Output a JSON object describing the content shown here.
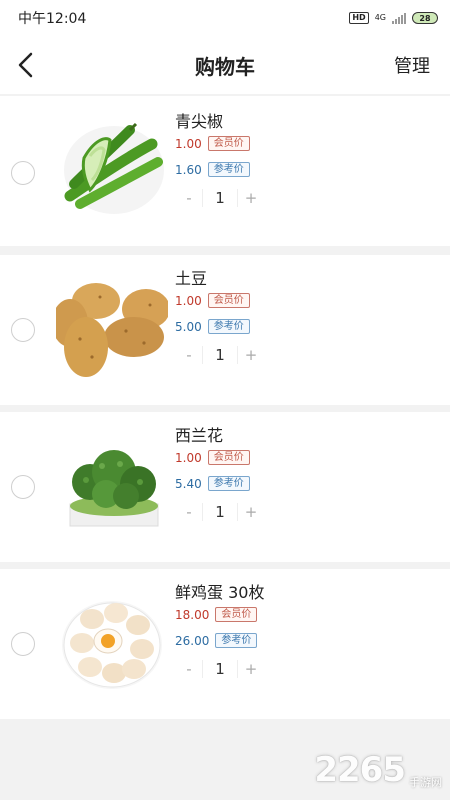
{
  "status": {
    "time": "中午12:04",
    "network": "4G",
    "battery": "28"
  },
  "header": {
    "title": "购物车",
    "manage": "管理"
  },
  "items": [
    {
      "name": "青尖椒",
      "member_price": "1.00",
      "member_tag": "会员价",
      "ref_price": "1.60",
      "ref_tag": "参考价",
      "minus": "-",
      "qty": "1",
      "plus": "+"
    },
    {
      "name": "土豆",
      "member_price": "1.00",
      "member_tag": "会员价",
      "ref_price": "5.00",
      "ref_tag": "参考价",
      "minus": "-",
      "qty": "1",
      "plus": "+"
    },
    {
      "name": "西兰花",
      "member_price": "1.00",
      "member_tag": "会员价",
      "ref_price": "5.40",
      "ref_tag": "参考价",
      "minus": "-",
      "qty": "1",
      "plus": "+"
    },
    {
      "name": "鲜鸡蛋 30枚",
      "member_price": "18.00",
      "member_tag": "会员价",
      "ref_price": "26.00",
      "ref_tag": "参考价",
      "minus": "-",
      "qty": "1",
      "plus": "+"
    }
  ],
  "watermark": {
    "number": "2265",
    "text": "手游网"
  },
  "colors": {
    "member": "#c0392b",
    "reference": "#2d6ca2",
    "background": "#f2f2f2"
  }
}
